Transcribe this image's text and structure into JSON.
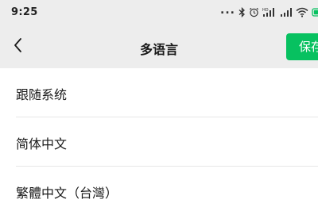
{
  "status_bar": {
    "time": "9:25",
    "overflow": "...",
    "icons": [
      "bluetooth-icon",
      "alarm-icon",
      "hd-signal-icon",
      "cell-signal-icon",
      "wifi-icon",
      "battery-icon"
    ]
  },
  "nav": {
    "back_icon": "chevron-left-icon",
    "title": "多语言",
    "save_label": "保存"
  },
  "languages": [
    {
      "label": "跟随系统"
    },
    {
      "label": "简体中文"
    },
    {
      "label": "繁體中文（台灣）"
    }
  ],
  "colors": {
    "accent": "#07c160",
    "background": "#ededed",
    "list_background": "#ffffff",
    "text": "#191919",
    "divider": "#e6e6e6"
  }
}
